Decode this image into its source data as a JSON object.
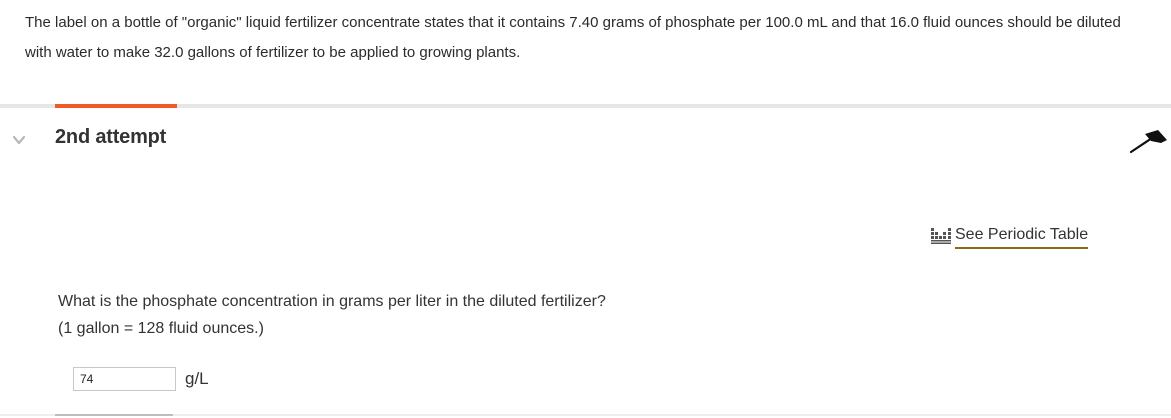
{
  "problem": {
    "text": "The label on a bottle of \"organic\" liquid fertilizer concentrate states that it contains 7.40 grams of phosphate per 100.0 mL and that 16.0 fluid ounces should be diluted with water to make 32.0 gallons of fertilizer to be applied to growing plants."
  },
  "attempt": {
    "title": "2nd attempt",
    "accent_color": "#f05a28",
    "collapse_icon": "chevron-down-icon",
    "pin_icon": "pin-icon"
  },
  "tools": {
    "periodic_table_label": "See Periodic Table",
    "periodic_table_icon": "periodic-table-icon"
  },
  "question": {
    "line1": "What is the phosphate concentration in grams per liter in the diluted fertilizer?",
    "line2": "(1 gallon = 128 fluid ounces.)"
  },
  "answer": {
    "value": "74",
    "unit": "g/L"
  }
}
